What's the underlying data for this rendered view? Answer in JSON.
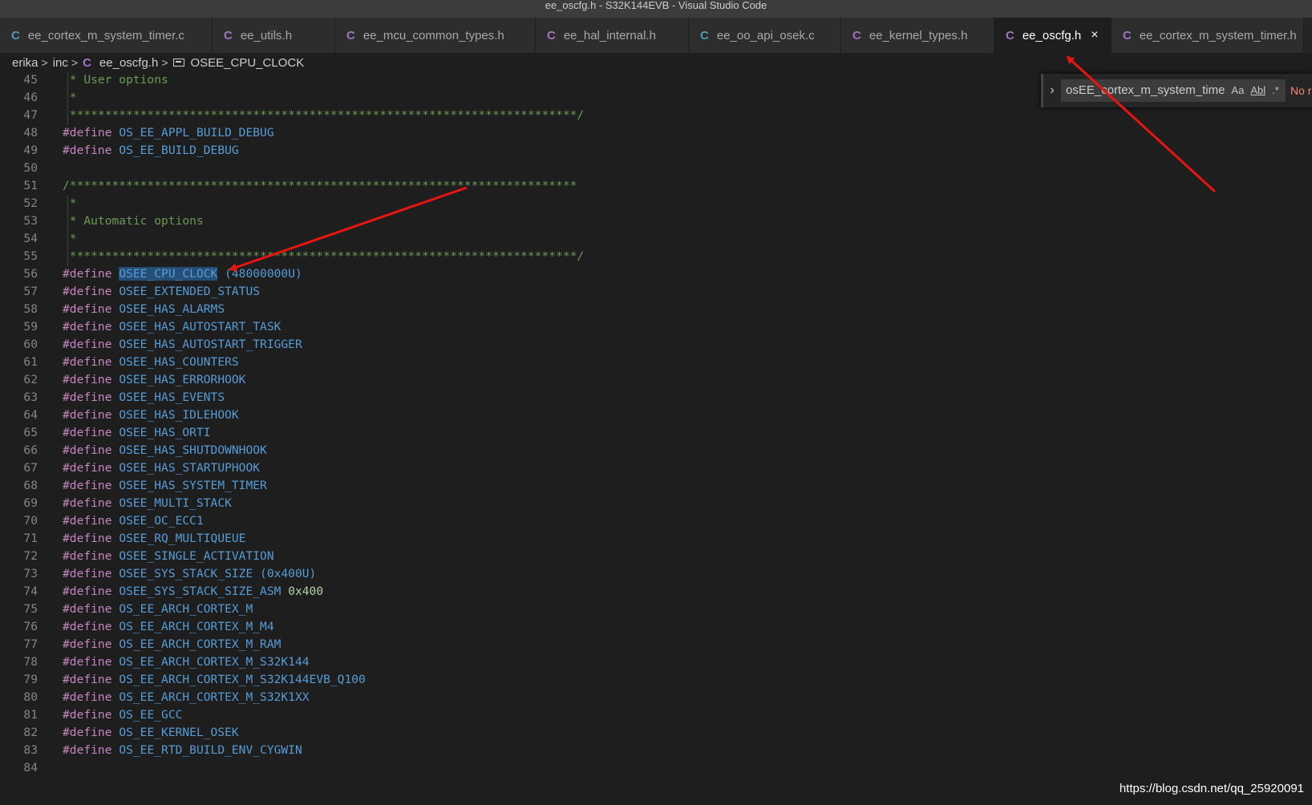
{
  "window": {
    "title": "ee_oscfg.h - S32K144EVB - Visual Studio Code"
  },
  "tabs": [
    {
      "label": "ee_cortex_m_system_timer.c",
      "icon_color": "#519aba",
      "active": false
    },
    {
      "label": "ee_utils.h",
      "icon_color": "#a074c4",
      "active": false
    },
    {
      "label": "ee_mcu_common_types.h",
      "icon_color": "#a074c4",
      "active": false
    },
    {
      "label": "ee_hal_internal.h",
      "icon_color": "#a074c4",
      "active": false
    },
    {
      "label": "ee_oo_api_osek.c",
      "icon_color": "#519aba",
      "active": false
    },
    {
      "label": "ee_kernel_types.h",
      "icon_color": "#a074c4",
      "active": false
    },
    {
      "label": "ee_oscfg.h",
      "icon_color": "#a074c4",
      "active": true
    },
    {
      "label": "ee_cortex_m_system_timer.h",
      "icon_color": "#a074c4",
      "active": false
    }
  ],
  "tab_icon_glyph": "C",
  "tab_close_glyph": "×",
  "breadcrumb": {
    "items": [
      "erika",
      "inc",
      "ee_oscfg.h",
      "OSEE_CPU_CLOCK"
    ],
    "separator": ">"
  },
  "find_widget": {
    "value": "osEE_cortex_m_system_time",
    "toggle_glyph": "›",
    "match_case": "Aa",
    "whole_word": "Abl",
    "regex": ".*",
    "status": "No r"
  },
  "editor": {
    "lines": [
      {
        "num": "45",
        "tokens": [
          {
            "t": " * User options",
            "c": "comment"
          }
        ]
      },
      {
        "num": "46",
        "tokens": [
          {
            "t": " *",
            "c": "comment"
          }
        ]
      },
      {
        "num": "47",
        "tokens": [
          {
            "t": " ************************************************************************/",
            "c": "comment"
          }
        ]
      },
      {
        "num": "48",
        "tokens": [
          {
            "t": "#define",
            "c": "kw"
          },
          {
            "t": " ",
            "c": "plain"
          },
          {
            "t": "OS_EE_APPL_BUILD_DEBUG",
            "c": "mac"
          }
        ]
      },
      {
        "num": "49",
        "tokens": [
          {
            "t": "#define",
            "c": "kw"
          },
          {
            "t": " ",
            "c": "plain"
          },
          {
            "t": "OS_EE_BUILD_DEBUG",
            "c": "mac"
          }
        ]
      },
      {
        "num": "50",
        "tokens": []
      },
      {
        "num": "51",
        "tokens": [
          {
            "t": "/************************************************************************",
            "c": "comment"
          }
        ]
      },
      {
        "num": "52",
        "tokens": [
          {
            "t": " *",
            "c": "comment"
          }
        ]
      },
      {
        "num": "53",
        "tokens": [
          {
            "t": " * Automatic options",
            "c": "comment"
          }
        ]
      },
      {
        "num": "54",
        "tokens": [
          {
            "t": " *",
            "c": "comment"
          }
        ]
      },
      {
        "num": "55",
        "tokens": [
          {
            "t": " ************************************************************************/",
            "c": "comment"
          }
        ]
      },
      {
        "num": "56",
        "tokens": [
          {
            "t": "#define",
            "c": "kw"
          },
          {
            "t": " ",
            "c": "plain"
          },
          {
            "t": "OSEE_CPU_CLOCK",
            "c": "mac-sel"
          },
          {
            "t": " (48000000U)",
            "c": "mac"
          }
        ]
      },
      {
        "num": "57",
        "tokens": [
          {
            "t": "#define",
            "c": "kw"
          },
          {
            "t": " ",
            "c": "plain"
          },
          {
            "t": "OSEE_EXTENDED_STATUS",
            "c": "mac"
          }
        ]
      },
      {
        "num": "58",
        "tokens": [
          {
            "t": "#define",
            "c": "kw"
          },
          {
            "t": " ",
            "c": "plain"
          },
          {
            "t": "OSEE_HAS_ALARMS",
            "c": "mac"
          }
        ]
      },
      {
        "num": "59",
        "tokens": [
          {
            "t": "#define",
            "c": "kw"
          },
          {
            "t": " ",
            "c": "plain"
          },
          {
            "t": "OSEE_HAS_AUTOSTART_TASK",
            "c": "mac"
          }
        ]
      },
      {
        "num": "60",
        "tokens": [
          {
            "t": "#define",
            "c": "kw"
          },
          {
            "t": " ",
            "c": "plain"
          },
          {
            "t": "OSEE_HAS_AUTOSTART_TRIGGER",
            "c": "mac"
          }
        ]
      },
      {
        "num": "61",
        "tokens": [
          {
            "t": "#define",
            "c": "kw"
          },
          {
            "t": " ",
            "c": "plain"
          },
          {
            "t": "OSEE_HAS_COUNTERS",
            "c": "mac"
          }
        ]
      },
      {
        "num": "62",
        "tokens": [
          {
            "t": "#define",
            "c": "kw"
          },
          {
            "t": " ",
            "c": "plain"
          },
          {
            "t": "OSEE_HAS_ERRORHOOK",
            "c": "mac"
          }
        ]
      },
      {
        "num": "63",
        "tokens": [
          {
            "t": "#define",
            "c": "kw"
          },
          {
            "t": " ",
            "c": "plain"
          },
          {
            "t": "OSEE_HAS_EVENTS",
            "c": "mac"
          }
        ]
      },
      {
        "num": "64",
        "tokens": [
          {
            "t": "#define",
            "c": "kw"
          },
          {
            "t": " ",
            "c": "plain"
          },
          {
            "t": "OSEE_HAS_IDLEHOOK",
            "c": "mac"
          }
        ]
      },
      {
        "num": "65",
        "tokens": [
          {
            "t": "#define",
            "c": "kw"
          },
          {
            "t": " ",
            "c": "plain"
          },
          {
            "t": "OSEE_HAS_ORTI",
            "c": "mac"
          }
        ]
      },
      {
        "num": "66",
        "tokens": [
          {
            "t": "#define",
            "c": "kw"
          },
          {
            "t": " ",
            "c": "plain"
          },
          {
            "t": "OSEE_HAS_SHUTDOWNHOOK",
            "c": "mac"
          }
        ]
      },
      {
        "num": "67",
        "tokens": [
          {
            "t": "#define",
            "c": "kw"
          },
          {
            "t": " ",
            "c": "plain"
          },
          {
            "t": "OSEE_HAS_STARTUPHOOK",
            "c": "mac"
          }
        ]
      },
      {
        "num": "68",
        "tokens": [
          {
            "t": "#define",
            "c": "kw"
          },
          {
            "t": " ",
            "c": "plain"
          },
          {
            "t": "OSEE_HAS_SYSTEM_TIMER",
            "c": "mac"
          }
        ]
      },
      {
        "num": "69",
        "tokens": [
          {
            "t": "#define",
            "c": "kw"
          },
          {
            "t": " ",
            "c": "plain"
          },
          {
            "t": "OSEE_MULTI_STACK",
            "c": "mac"
          }
        ]
      },
      {
        "num": "70",
        "tokens": [
          {
            "t": "#define",
            "c": "kw"
          },
          {
            "t": " ",
            "c": "plain"
          },
          {
            "t": "OSEE_OC_ECC1",
            "c": "mac"
          }
        ]
      },
      {
        "num": "71",
        "tokens": [
          {
            "t": "#define",
            "c": "kw"
          },
          {
            "t": " ",
            "c": "plain"
          },
          {
            "t": "OSEE_RQ_MULTIQUEUE",
            "c": "mac"
          }
        ]
      },
      {
        "num": "72",
        "tokens": [
          {
            "t": "#define",
            "c": "kw"
          },
          {
            "t": " ",
            "c": "plain"
          },
          {
            "t": "OSEE_SINGLE_ACTIVATION",
            "c": "mac"
          }
        ]
      },
      {
        "num": "73",
        "tokens": [
          {
            "t": "#define",
            "c": "kw"
          },
          {
            "t": " ",
            "c": "plain"
          },
          {
            "t": "OSEE_SYS_STACK_SIZE (0x400U)",
            "c": "mac"
          }
        ]
      },
      {
        "num": "74",
        "tokens": [
          {
            "t": "#define",
            "c": "kw"
          },
          {
            "t": " ",
            "c": "plain"
          },
          {
            "t": "OSEE_SYS_STACK_SIZE_ASM",
            "c": "mac"
          },
          {
            "t": " ",
            "c": "plain"
          },
          {
            "t": "0x400",
            "c": "num"
          }
        ]
      },
      {
        "num": "75",
        "tokens": [
          {
            "t": "#define",
            "c": "kw"
          },
          {
            "t": " ",
            "c": "plain"
          },
          {
            "t": "OS_EE_ARCH_CORTEX_M",
            "c": "mac"
          }
        ]
      },
      {
        "num": "76",
        "tokens": [
          {
            "t": "#define",
            "c": "kw"
          },
          {
            "t": " ",
            "c": "plain"
          },
          {
            "t": "OS_EE_ARCH_CORTEX_M_M4",
            "c": "mac"
          }
        ]
      },
      {
        "num": "77",
        "tokens": [
          {
            "t": "#define",
            "c": "kw"
          },
          {
            "t": " ",
            "c": "plain"
          },
          {
            "t": "OS_EE_ARCH_CORTEX_M_RAM",
            "c": "mac"
          }
        ]
      },
      {
        "num": "78",
        "tokens": [
          {
            "t": "#define",
            "c": "kw"
          },
          {
            "t": " ",
            "c": "plain"
          },
          {
            "t": "OS_EE_ARCH_CORTEX_M_S32K144",
            "c": "mac"
          }
        ]
      },
      {
        "num": "79",
        "tokens": [
          {
            "t": "#define",
            "c": "kw"
          },
          {
            "t": " ",
            "c": "plain"
          },
          {
            "t": "OS_EE_ARCH_CORTEX_M_S32K144EVB_Q100",
            "c": "mac"
          }
        ]
      },
      {
        "num": "80",
        "tokens": [
          {
            "t": "#define",
            "c": "kw"
          },
          {
            "t": " ",
            "c": "plain"
          },
          {
            "t": "OS_EE_ARCH_CORTEX_M_S32K1XX",
            "c": "mac"
          }
        ]
      },
      {
        "num": "81",
        "tokens": [
          {
            "t": "#define",
            "c": "kw"
          },
          {
            "t": " ",
            "c": "plain"
          },
          {
            "t": "OS_EE_GCC",
            "c": "mac"
          }
        ]
      },
      {
        "num": "82",
        "tokens": [
          {
            "t": "#define",
            "c": "kw"
          },
          {
            "t": " ",
            "c": "plain"
          },
          {
            "t": "OS_EE_KERNEL_OSEK",
            "c": "mac"
          }
        ]
      },
      {
        "num": "83",
        "tokens": [
          {
            "t": "#define",
            "c": "kw"
          },
          {
            "t": " ",
            "c": "plain"
          },
          {
            "t": "OS_EE_RTD_BUILD_ENV_CYGWIN",
            "c": "mac"
          }
        ]
      },
      {
        "num": "84",
        "tokens": []
      }
    ]
  },
  "watermark": "https://blog.csdn.net/qq_25920091",
  "colors": {
    "annotation_arrow": "#e8140f",
    "selection": "#264f78",
    "keyword": "#c586c0",
    "macro": "#569cd6",
    "comment": "#6a9955",
    "number": "#b5cea8"
  }
}
